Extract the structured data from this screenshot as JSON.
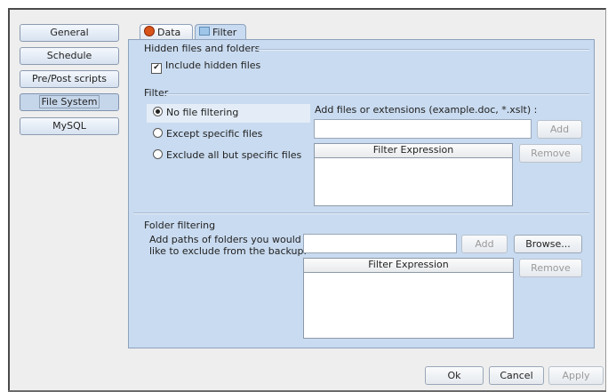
{
  "sidebar": {
    "items": [
      {
        "label": "General"
      },
      {
        "label": "Schedule"
      },
      {
        "label": "Pre/Post scripts"
      },
      {
        "label": "File System"
      },
      {
        "label": "MySQL"
      }
    ],
    "active": "File System"
  },
  "tabs": [
    {
      "label": "Data",
      "icon": "data-icon"
    },
    {
      "label": "Filter",
      "icon": "filter-icon"
    }
  ],
  "hidden": {
    "group_title": "Hidden files and folders",
    "checkbox_label": "Include hidden files",
    "checked": true
  },
  "filter": {
    "group_title": "Filter",
    "options": [
      {
        "label": "No file filtering",
        "selected": true
      },
      {
        "label": "Except specific files",
        "selected": false
      },
      {
        "label": "Exclude all but specific files",
        "selected": false
      }
    ],
    "add_label": "Add files or extensions (example.doc, *.xslt) :",
    "input_value": "",
    "add_button": "Add",
    "remove_button": "Remove",
    "list_header": "Filter Expression"
  },
  "folder": {
    "group_title": "Folder filtering",
    "description_line1": "Add paths of folders you would",
    "description_line2": "like to exclude from the backup.",
    "input_value": "",
    "add_button": "Add",
    "browse_button": "Browse...",
    "remove_button": "Remove",
    "list_header": "Filter Expression"
  },
  "footer": {
    "ok": "Ok",
    "cancel": "Cancel",
    "apply": "Apply"
  },
  "colors": {
    "panel": "#c9dbf0",
    "accent": "#8ea2bc"
  }
}
